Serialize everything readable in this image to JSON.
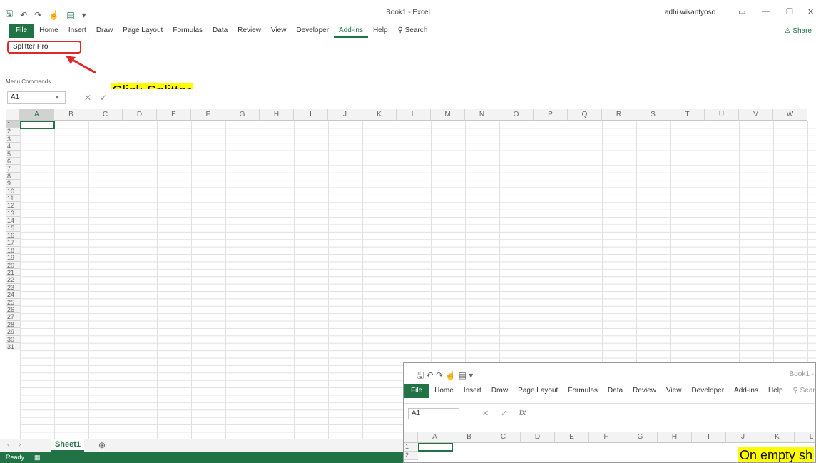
{
  "window": {
    "title": "Book1 - Excel",
    "user": "adhi wikantyoso",
    "share_label": "Share"
  },
  "qat": {
    "save_icon": "save-icon",
    "undo_icon": "undo-icon",
    "redo_icon": "redo-icon",
    "touch_icon": "touch-mode-icon",
    "form_icon": "form-icon",
    "customize": "▾"
  },
  "tabs": [
    "File",
    "Home",
    "Insert",
    "Draw",
    "Page Layout",
    "Formulas",
    "Data",
    "Review",
    "View",
    "Developer",
    "Add-ins",
    "Help"
  ],
  "active_tab": "Add-ins",
  "search_label": "Search",
  "ribbon": {
    "button_label": "Splitter Pro",
    "group_label": "Menu Commands"
  },
  "annotation": {
    "callout": "Click Splitter",
    "inset_callout": "On empty sh"
  },
  "formula_bar": {
    "name_box": "A1",
    "cancel": "✕",
    "enter": "✓",
    "fx": "fx"
  },
  "columns": [
    "A",
    "B",
    "C",
    "D",
    "E",
    "F",
    "G",
    "H",
    "I",
    "J",
    "K",
    "L",
    "M",
    "N",
    "O",
    "P",
    "Q",
    "R",
    "S",
    "T",
    "U",
    "V",
    "W"
  ],
  "rows": [
    "1",
    "2",
    "3",
    "4",
    "5",
    "6",
    "7",
    "8",
    "9",
    "10",
    "11",
    "12",
    "13",
    "14",
    "15",
    "16",
    "17",
    "18",
    "19",
    "20",
    "21",
    "22",
    "23",
    "24",
    "25",
    "26",
    "27",
    "28",
    "29",
    "30",
    "31"
  ],
  "sheet_tab": "Sheet1",
  "status": "Ready",
  "inset": {
    "title": "Book1 -",
    "tabs": [
      "File",
      "Home",
      "Insert",
      "Draw",
      "Page Layout",
      "Formulas",
      "Data",
      "Review",
      "View",
      "Developer",
      "Add-ins",
      "Help"
    ],
    "search_label": "Search",
    "name_box": "A1",
    "columns": [
      "A",
      "B",
      "C",
      "D",
      "E",
      "F",
      "G",
      "H",
      "I",
      "J",
      "K",
      "L"
    ],
    "rows": [
      "1",
      "2"
    ]
  }
}
